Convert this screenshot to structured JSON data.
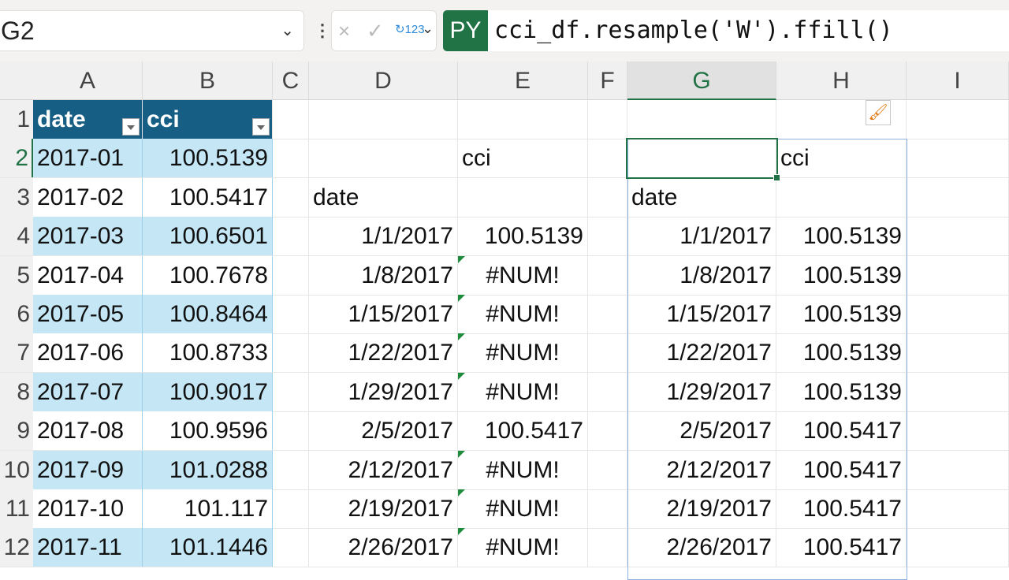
{
  "name_box": "G2",
  "formula_bar": {
    "py_badge": "PY",
    "formula": "cci_df.resample('W').ffill()",
    "cancel_icon": "×",
    "enter_icon": "✓",
    "convert_icon": "↻123"
  },
  "columns": [
    "A",
    "B",
    "C",
    "D",
    "E",
    "F",
    "G",
    "H",
    "I"
  ],
  "selected_column": "G",
  "row_numbers": [
    "1",
    "2",
    "3",
    "4",
    "5",
    "6",
    "7",
    "8",
    "9",
    "10",
    "11",
    "12"
  ],
  "table": {
    "headers": [
      "date",
      "cci"
    ],
    "rows": [
      [
        "2017-01",
        "100.5139"
      ],
      [
        "2017-02",
        "100.5417"
      ],
      [
        "2017-03",
        "100.6501"
      ],
      [
        "2017-04",
        "100.7678"
      ],
      [
        "2017-05",
        "100.8464"
      ],
      [
        "2017-06",
        "100.8733"
      ],
      [
        "2017-07",
        "100.9017"
      ],
      [
        "2017-08",
        "100.9596"
      ],
      [
        "2017-09",
        "101.0288"
      ],
      [
        "2017-10",
        "101.117"
      ],
      [
        "2017-11",
        "101.1446"
      ]
    ]
  },
  "output1": {
    "col_header": "cci",
    "index_header": "date",
    "rows": [
      [
        "1/1/2017",
        "100.5139"
      ],
      [
        "1/8/2017",
        "#NUM!"
      ],
      [
        "1/15/2017",
        "#NUM!"
      ],
      [
        "1/22/2017",
        "#NUM!"
      ],
      [
        "1/29/2017",
        "#NUM!"
      ],
      [
        "2/5/2017",
        "100.5417"
      ],
      [
        "2/12/2017",
        "#NUM!"
      ],
      [
        "2/19/2017",
        "#NUM!"
      ],
      [
        "2/26/2017",
        "#NUM!"
      ]
    ]
  },
  "output2": {
    "col_header": "cci",
    "index_header": "date",
    "rows": [
      [
        "1/1/2017",
        "100.5139"
      ],
      [
        "1/8/2017",
        "100.5139"
      ],
      [
        "1/15/2017",
        "100.5139"
      ],
      [
        "1/22/2017",
        "100.5139"
      ],
      [
        "1/29/2017",
        "100.5139"
      ],
      [
        "2/5/2017",
        "100.5417"
      ],
      [
        "2/12/2017",
        "100.5417"
      ],
      [
        "2/19/2017",
        "100.5417"
      ],
      [
        "2/26/2017",
        "100.5417"
      ]
    ]
  }
}
